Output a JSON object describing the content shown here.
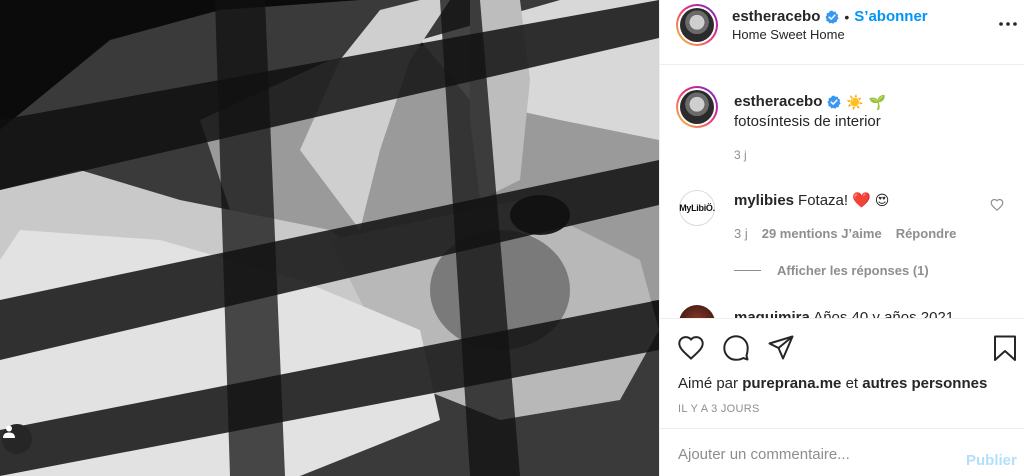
{
  "post": {
    "author": "estheracebo",
    "follow_label": "S’abonner",
    "separator": "•",
    "location": "Home Sweet Home",
    "caption": {
      "username": "estheracebo",
      "emojis": [
        "☀️",
        "🌱"
      ],
      "text": "fotosíntesis de interior",
      "time": "3 j"
    },
    "comments": [
      {
        "username": "mylibies",
        "avatar_text": "MyLibiÖ.",
        "text": "Fotaza!",
        "emojis": [
          "❤️",
          "😍"
        ],
        "time": "3 j",
        "likes": "29 mentions J’aime",
        "reply_label": "Répondre",
        "view_replies_label": "Afficher les réponses (1)"
      },
      {
        "username": "maquimira",
        "text": "Años 40 y años 2021"
      }
    ],
    "likes_prefix": "Aimé par",
    "likes_user": "pureprana.me",
    "likes_and": "et",
    "likes_others": "autres personnes",
    "posted_ago": "IL Y A 3 JOURS",
    "comment_placeholder": "Ajouter un commentaire...",
    "publish_label": "Publier"
  },
  "icons": {
    "more": "more-horizontal-icon",
    "like": "heart-icon",
    "comment": "comment-bubble-icon",
    "share": "paper-plane-icon",
    "save": "bookmark-icon",
    "user_tag": "user-tag-icon",
    "verified": "verified-badge-icon"
  },
  "colors": {
    "accent": "#0095f6",
    "verified": "#3897f0",
    "publish_disabled": "#b2dffc",
    "muted_text": "#8e8e8e",
    "heart": "#ed4956"
  }
}
